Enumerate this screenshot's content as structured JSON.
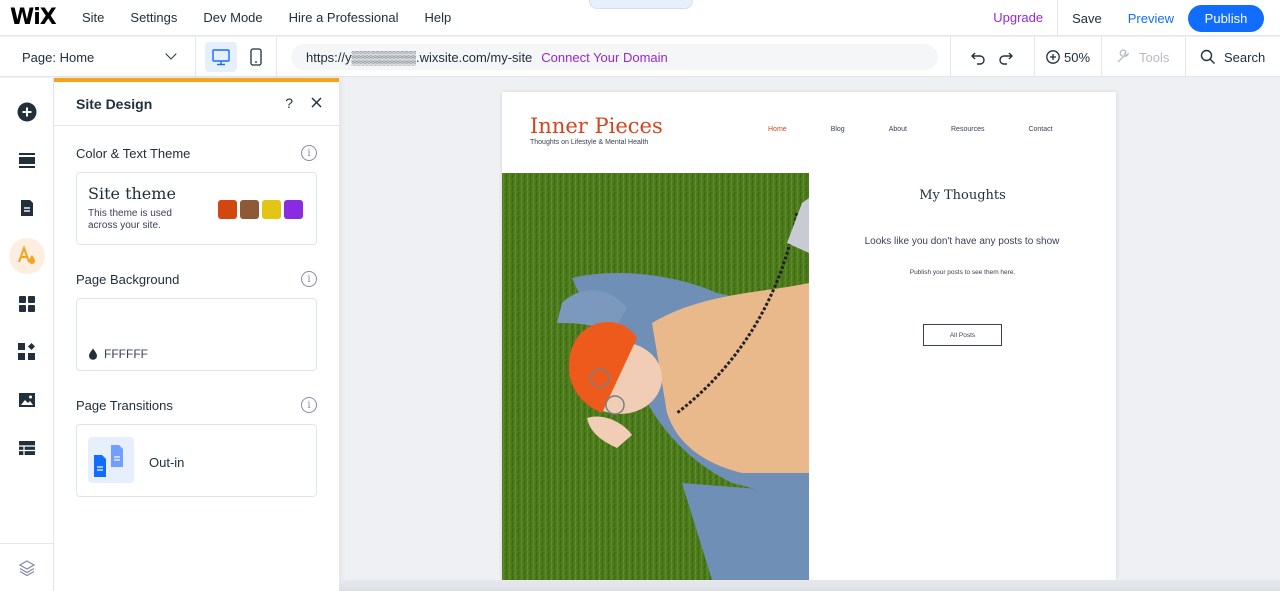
{
  "topbar": {
    "logo": "WiX",
    "menu": [
      "Site",
      "Settings",
      "Dev Mode",
      "Hire a Professional",
      "Help"
    ],
    "collapse_glyph": "⌃",
    "upgrade": "Upgrade",
    "save": "Save",
    "preview": "Preview",
    "publish": "Publish"
  },
  "toolbar": {
    "page_label": "Page: Home",
    "url": "https://y▒▒▒▒▒▒▒.wixsite.com/my-site",
    "connect_domain": "Connect Your Domain",
    "zoom": "50%",
    "tools": "Tools",
    "search": "Search"
  },
  "rail": {
    "icons": [
      "add-icon",
      "sections-icon",
      "pages-icon",
      "site-design-icon",
      "apps-icon",
      "business-apps-icon",
      "media-icon",
      "cms-icon"
    ],
    "active": "site-design-icon",
    "bottom_icon": "layers-icon",
    "accent_color": "#f7a21b"
  },
  "panel": {
    "title": "Site Design",
    "help": "?",
    "color_text_theme": {
      "label": "Color & Text Theme",
      "theme_name": "Site theme",
      "theme_desc": "This theme is used across your site.",
      "swatches": [
        "#d1470f",
        "#8e5a35",
        "#e3c516",
        "#8a2be2"
      ]
    },
    "page_background": {
      "label": "Page Background",
      "value": "FFFFFF"
    },
    "page_transitions": {
      "label": "Page Transitions",
      "value": "Out-in"
    },
    "info_glyph": "i"
  },
  "site": {
    "title": "Inner Pieces",
    "tagline": "Thoughts on Lifestyle & Mental Health",
    "nav": [
      "Home",
      "Blog",
      "About",
      "Resources",
      "Contact"
    ],
    "section_title": "My Thoughts",
    "empty_message": "Looks like you don't have any posts to show",
    "empty_hint": "Publish your posts to see them here.",
    "all_posts_button": "All Posts"
  }
}
